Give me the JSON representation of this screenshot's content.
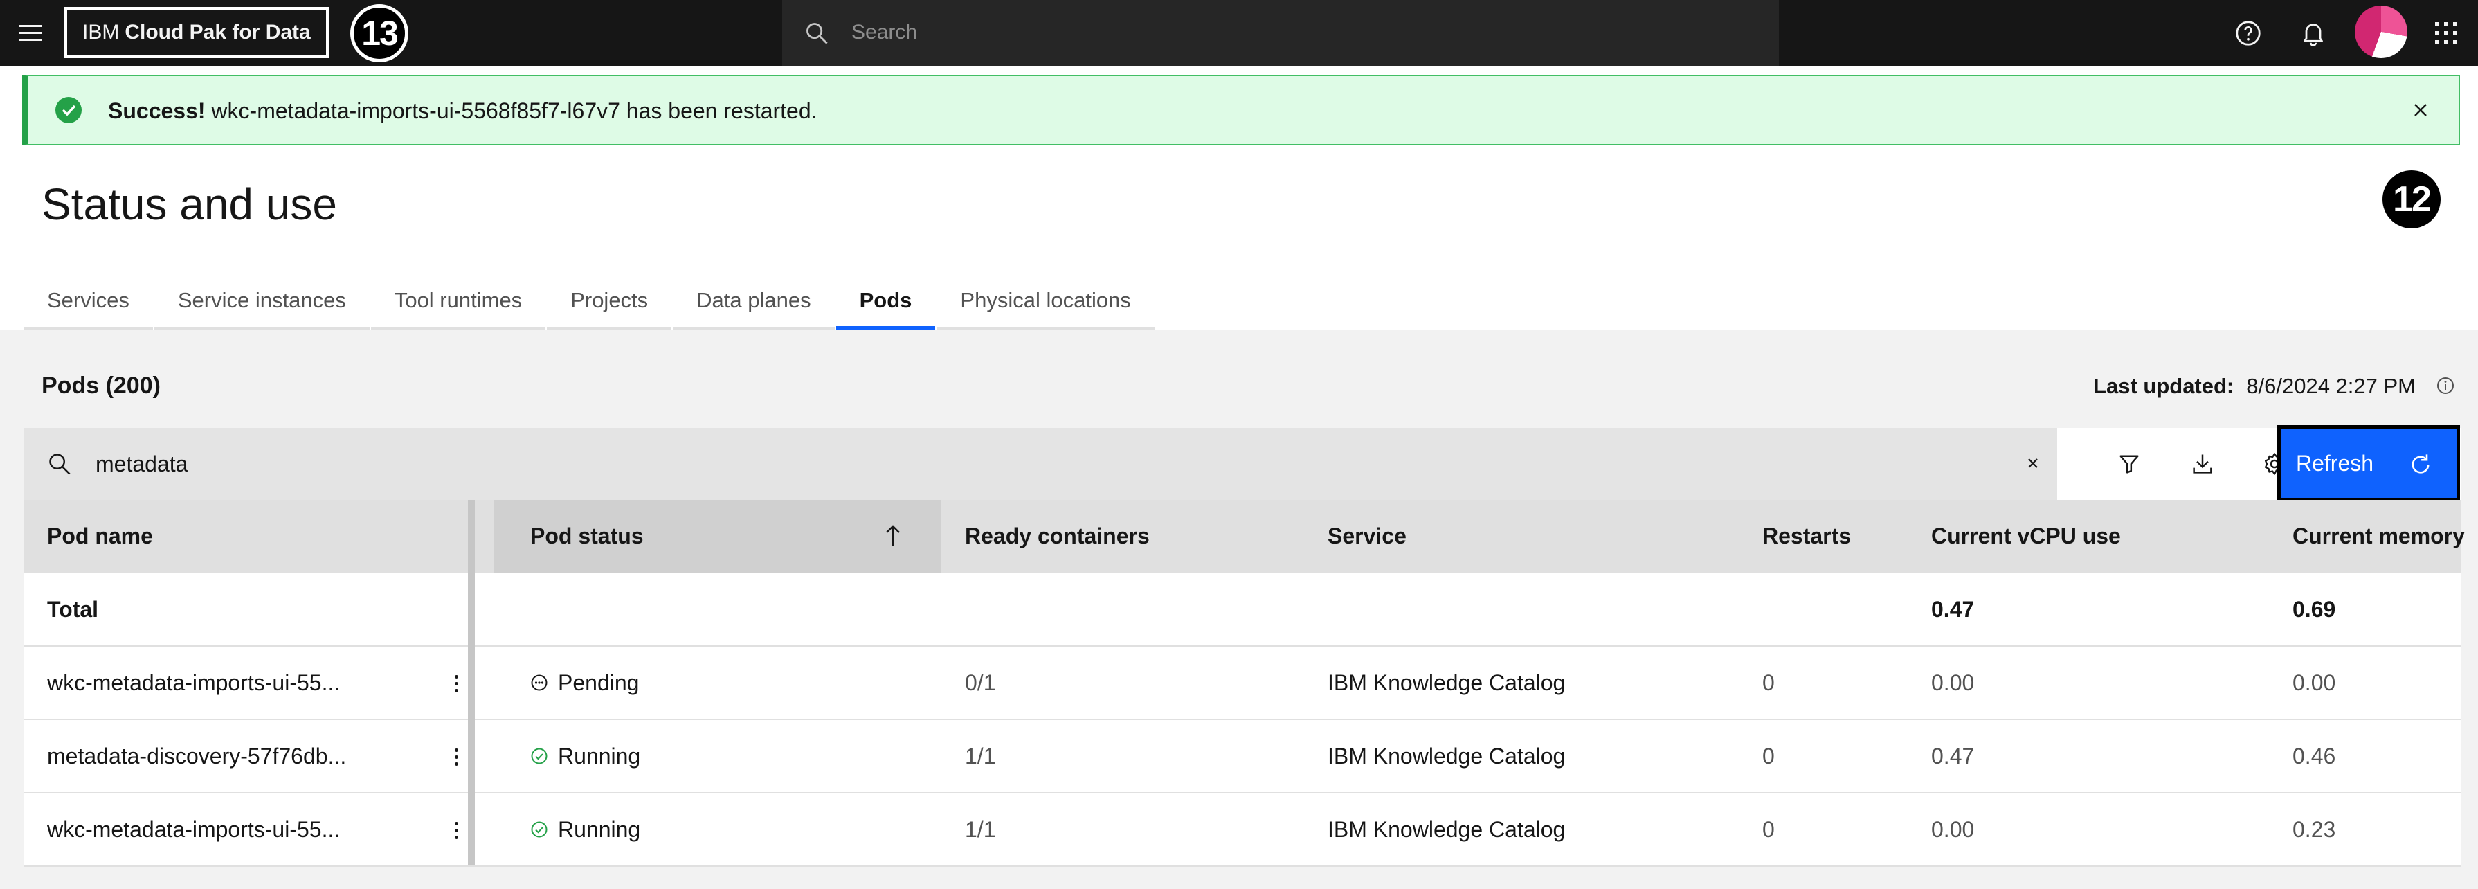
{
  "header": {
    "brand_prefix": "IBM",
    "brand_name": "Cloud Pak for Data",
    "search_placeholder": "Search",
    "annotation_left": "13"
  },
  "notification": {
    "title": "Success!",
    "message": "wkc-metadata-imports-ui-5568f85f7-l67v7 has been restarted."
  },
  "page": {
    "title": "Status and use",
    "annotation_right": "12"
  },
  "tabs": [
    {
      "label": "Services",
      "active": false
    },
    {
      "label": "Service instances",
      "active": false
    },
    {
      "label": "Tool runtimes",
      "active": false
    },
    {
      "label": "Projects",
      "active": false
    },
    {
      "label": "Data planes",
      "active": false
    },
    {
      "label": "Pods",
      "active": true
    },
    {
      "label": "Physical locations",
      "active": false
    }
  ],
  "pods": {
    "title": "Pods (200)",
    "last_updated_label": "Last updated:",
    "last_updated_value": "8/6/2024 2:27 PM",
    "search_value": "metadata",
    "refresh_label": "Refresh"
  },
  "table": {
    "columns": [
      "Pod name",
      "Pod status",
      "Ready containers",
      "Service",
      "Restarts",
      "Current vCPU use",
      "Current memory"
    ],
    "total": {
      "label": "Total",
      "vcpu": "0.47",
      "memory": "0.69"
    },
    "rows": [
      {
        "name": "wkc-metadata-imports-ui-55...",
        "status": "Pending",
        "ready": "0/1",
        "service": "IBM Knowledge Catalog",
        "restarts": "0",
        "vcpu": "0.00",
        "memory": "0.00"
      },
      {
        "name": "metadata-discovery-57f76db...",
        "status": "Running",
        "ready": "1/1",
        "service": "IBM Knowledge Catalog",
        "restarts": "0",
        "vcpu": "0.47",
        "memory": "0.46"
      },
      {
        "name": "wkc-metadata-imports-ui-55...",
        "status": "Running",
        "ready": "1/1",
        "service": "IBM Knowledge Catalog",
        "restarts": "0",
        "vcpu": "0.00",
        "memory": "0.23"
      }
    ]
  },
  "colors": {
    "header_bg": "#161616",
    "accent": "#0f62fe",
    "success_bg": "#defbe6",
    "success_icon": "#24a148"
  }
}
